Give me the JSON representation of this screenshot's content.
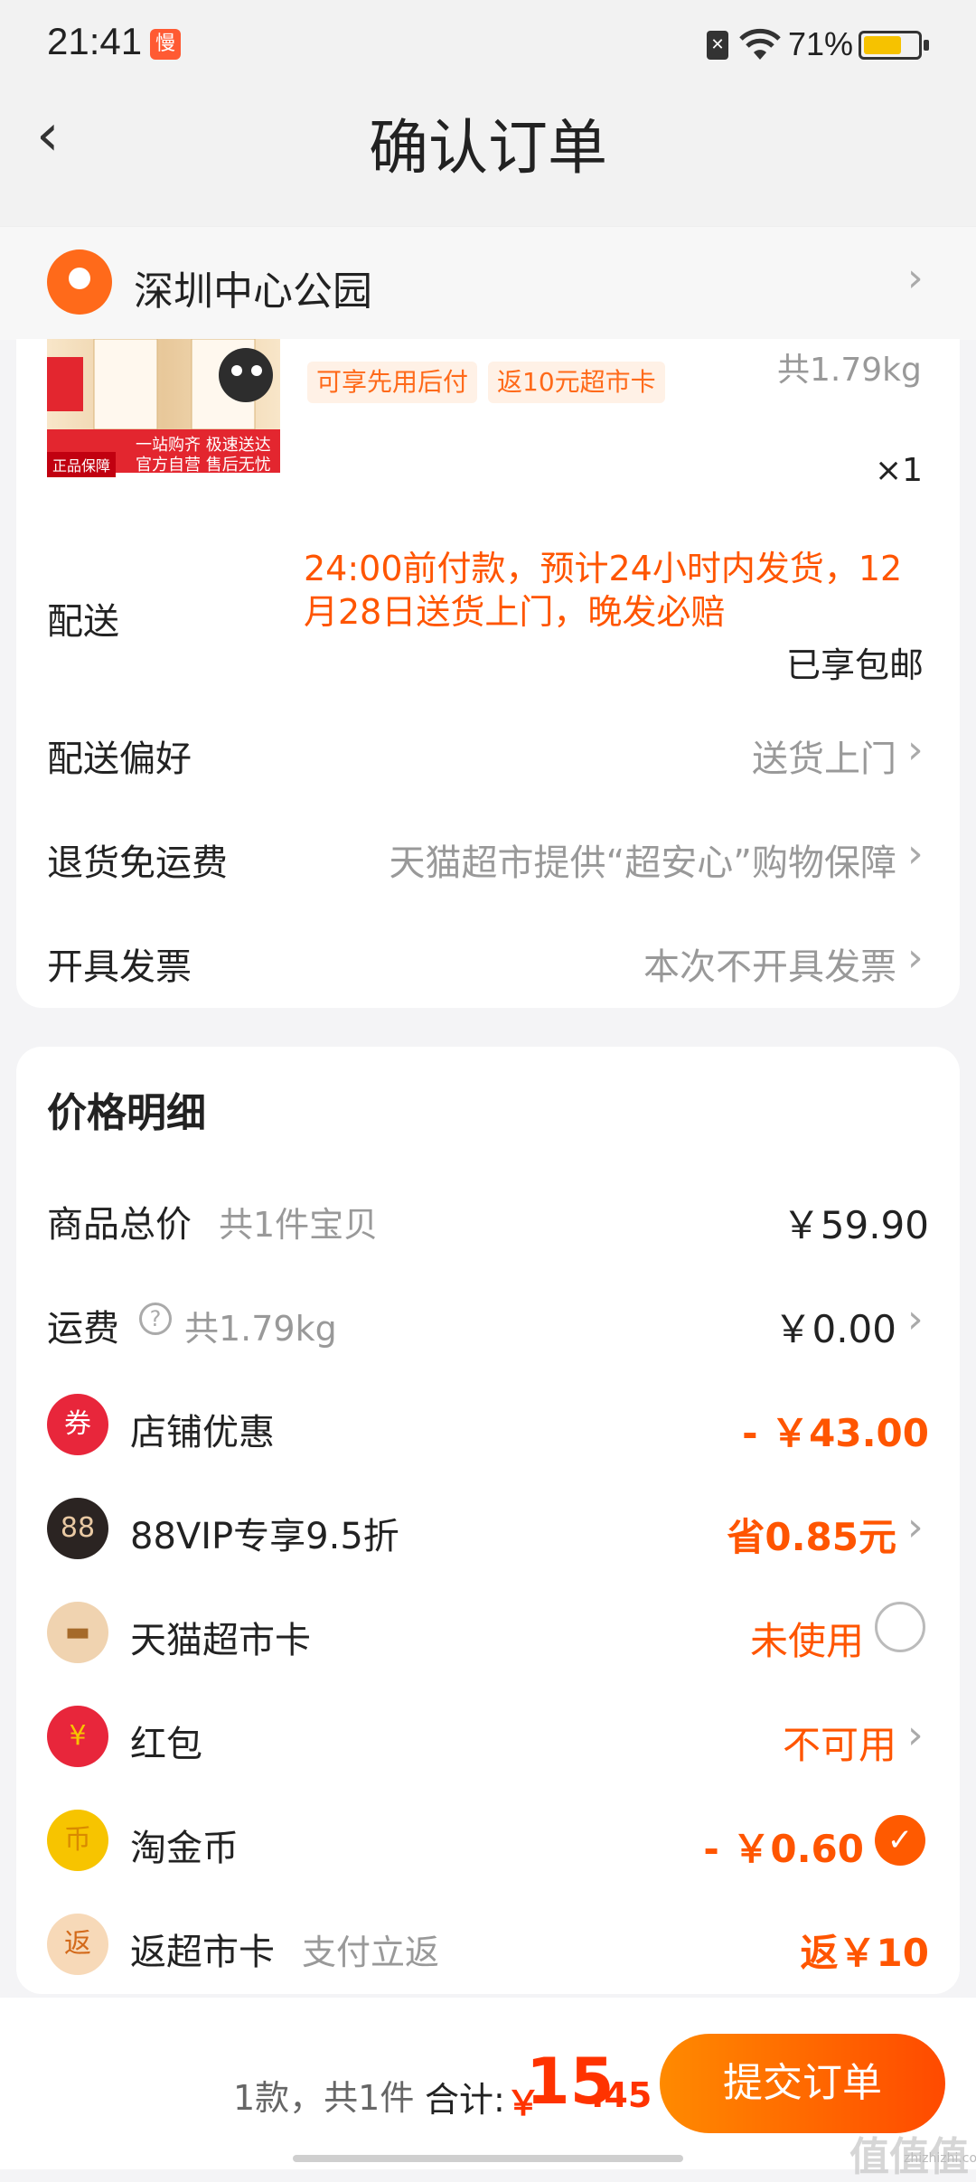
{
  "status_bar": {
    "time": "21:41",
    "notification_icon": "app-notification-icon",
    "notification_glyph": "慢",
    "battery_percent": "71%",
    "battery_level": 0.71,
    "sim_glyph": "✕"
  },
  "header": {
    "back_icon": "back-chevron-icon",
    "back_glyph": "‹",
    "title": "确认订单"
  },
  "address": {
    "text": "深圳中心公园",
    "icon": "location-pin-icon",
    "chevron": "›"
  },
  "product": {
    "image_tag": "正品保障",
    "image_slogan_1": "一站购齐 极速送达",
    "image_slogan_2": "官方自营 售后无忧",
    "tags": [
      "可享先用后付",
      "返10元超市卡"
    ],
    "weight": "共1.79kg",
    "quantity": "×1"
  },
  "delivery": {
    "label": "配送",
    "description": "24:00前付款，预计24小时内发货，12月28日送货上门，晚发必赔",
    "shipping": "已享包邮"
  },
  "options": [
    {
      "label": "配送偏好",
      "value": "送货上门",
      "chevron": "›"
    },
    {
      "label": "退货免运费",
      "value": "天猫超市提供“超安心”购物保障",
      "chevron": "›"
    },
    {
      "label": "开具发票",
      "value": "本次不开具发票",
      "chevron": "›"
    }
  ],
  "price_detail": {
    "title": "价格明细",
    "goods_total": {
      "label": "商品总价",
      "sub": "共1件宝贝",
      "amount": "￥59.90"
    },
    "freight": {
      "label": "运费",
      "help_glyph": "?",
      "sub": "共1.79kg",
      "amount": "￥0.00",
      "chevron": "›"
    },
    "rows": [
      {
        "label": "店铺优惠",
        "value": "- ￥43.00",
        "icon": "coupon-icon",
        "glyph": "券",
        "color": "#e8263b"
      },
      {
        "label": "88VIP专享9.5折",
        "value": "省0.85元",
        "icon": "vip88-icon",
        "glyph": "88",
        "color": "#2b2422",
        "chevron": "›"
      },
      {
        "label": "天猫超市卡",
        "value": "未使用",
        "icon": "card-icon",
        "glyph": "▬",
        "color": "#e9c9a3"
      },
      {
        "label": "红包",
        "value": "不可用",
        "icon": "red-packet-icon",
        "glyph": "¥",
        "color": "#e8263b",
        "chevron": "›"
      },
      {
        "label": "淘金币",
        "value": "- ￥0.60",
        "icon": "gold-coin-icon",
        "glyph": "币",
        "color": "#f7c400",
        "check_glyph": "✓"
      },
      {
        "label": "返超市卡",
        "sub": "支付立返",
        "value": "返￥10",
        "icon": "rebate-icon",
        "glyph": "返",
        "color": "#f7d9b8"
      }
    ]
  },
  "bottom_bar": {
    "count": "1款，共1件",
    "total_label": "合计:",
    "total_symbol": "￥",
    "total_integer": "15",
    "total_decimal": ".45",
    "submit": "提交订单"
  },
  "watermark": {
    "text": "值值值",
    "sub": "zhizhizhi.com"
  }
}
